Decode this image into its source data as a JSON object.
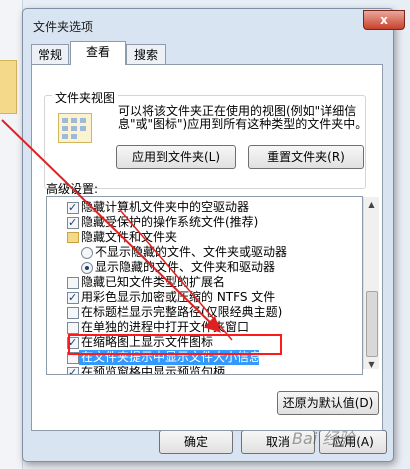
{
  "window": {
    "title": "文件夹选项",
    "close_label": "x"
  },
  "tabs": [
    {
      "label": "常规",
      "active": false
    },
    {
      "label": "查看",
      "active": true
    },
    {
      "label": "搜索",
      "active": false
    }
  ],
  "folder_view": {
    "group_label": "文件夹视图",
    "description": "可以将该文件夹正在使用的视图(例如\"详细信息\"或\"图标\")应用到所有这种类型的文件夹中。",
    "apply_button": "应用到文件夹(L)",
    "reset_button": "重置文件夹(R)"
  },
  "advanced": {
    "label": "高级设置:",
    "items": [
      {
        "type": "checkbox",
        "checked": true,
        "indent": 0,
        "label": "隐藏计算机文件夹中的空驱动器"
      },
      {
        "type": "checkbox",
        "checked": true,
        "indent": 0,
        "label": "隐藏受保护的操作系统文件(推荐)"
      },
      {
        "type": "folder",
        "indent": 0,
        "label": "隐藏文件和文件夹"
      },
      {
        "type": "radio",
        "checked": false,
        "indent": 1,
        "label": "不显示隐藏的文件、文件夹或驱动器"
      },
      {
        "type": "radio",
        "checked": true,
        "indent": 1,
        "label": "显示隐藏的文件、文件夹和驱动器"
      },
      {
        "type": "checkbox",
        "checked": false,
        "indent": 0,
        "label": "隐藏已知文件类型的扩展名"
      },
      {
        "type": "checkbox",
        "checked": true,
        "indent": 0,
        "label": "用彩色显示加密或压缩的 NTFS 文件"
      },
      {
        "type": "checkbox",
        "checked": false,
        "indent": 0,
        "label": "在标题栏显示完整路径(仅限经典主题)"
      },
      {
        "type": "checkbox",
        "checked": false,
        "indent": 0,
        "label": "在单独的进程中打开文件夹窗口"
      },
      {
        "type": "checkbox",
        "checked": true,
        "indent": 0,
        "label": "在缩略图上显示文件图标"
      },
      {
        "type": "checkbox",
        "checked": false,
        "indent": 0,
        "label": "在文件夹提示中显示文件大小信息",
        "highlighted": true
      },
      {
        "type": "checkbox",
        "checked": true,
        "indent": 0,
        "label": "在预览窗格中显示预览句柄"
      }
    ],
    "restore_button": "还原为默认值(D)"
  },
  "footer": {
    "ok": "确定",
    "cancel": "取消",
    "apply": "应用(A)"
  },
  "watermark": "Bai 经验",
  "colors": {
    "highlight_box": "#ff1a1a",
    "arrow": "#e02020",
    "selection": "#3399ff"
  }
}
